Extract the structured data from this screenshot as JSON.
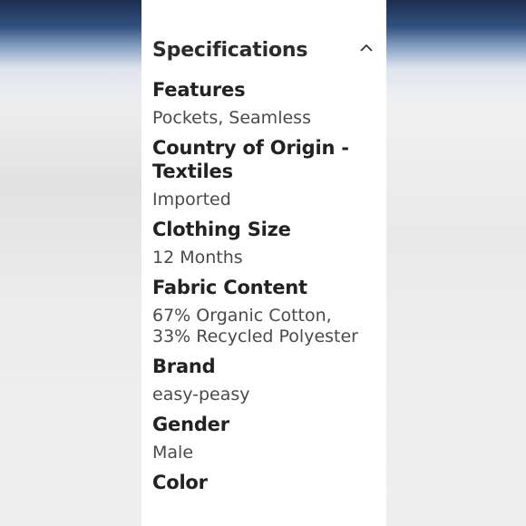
{
  "section": {
    "title": "Specifications"
  },
  "specs": [
    {
      "label": "Features",
      "value": "Pockets, Seamless"
    },
    {
      "label": "Country of Origin - Textiles",
      "value": "Imported"
    },
    {
      "label": "Clothing Size",
      "value": "12 Months"
    },
    {
      "label": "Fabric Content",
      "value": "67% Organic Cotton, 33% Recycled Polyester"
    },
    {
      "label": "Brand",
      "value": "easy-peasy"
    },
    {
      "label": "Gender",
      "value": "Male"
    },
    {
      "label": "Color",
      "value": ""
    }
  ],
  "icons": {
    "collapse": "chevron-up-icon",
    "top": "chevron-down-icon"
  }
}
